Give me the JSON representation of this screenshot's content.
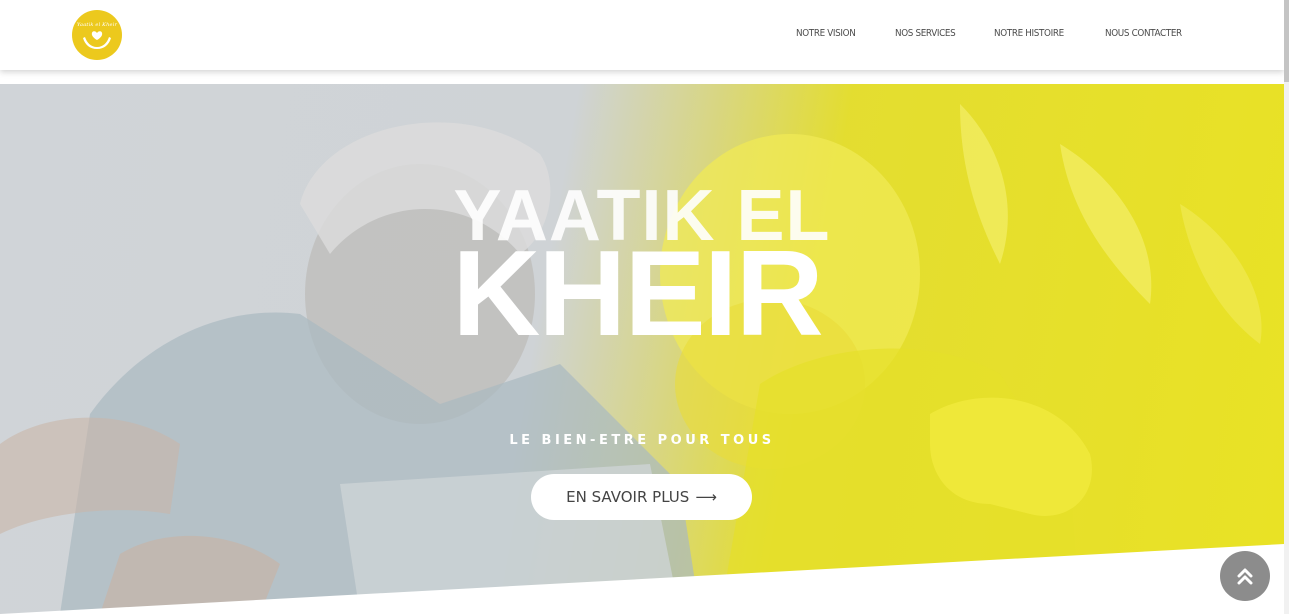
{
  "header": {
    "logo_text": "Yaatik el Kheir",
    "logo_icon": "hands-icon",
    "nav": [
      {
        "label": "NOTRE VISION"
      },
      {
        "label": "NOS SERVICES"
      },
      {
        "label": "NOTRE HISTOIRE"
      },
      {
        "label": "NOUS CONTACTER"
      }
    ]
  },
  "hero": {
    "title_line1": "YAATIK EL",
    "title_line2": "KHEIR",
    "subtitle": "LE BIEN-ETRE POUR TOUS",
    "button_label": "EN SAVOIR PLUS",
    "button_icon": "long-arrow-right-icon"
  },
  "back_to_top_icon": "double-chevron-up-icon",
  "colors": {
    "brand_yellow": "#ecc91d",
    "hero_yellow": "#e8e014",
    "back_to_top_bg": "#8c8c8c"
  }
}
